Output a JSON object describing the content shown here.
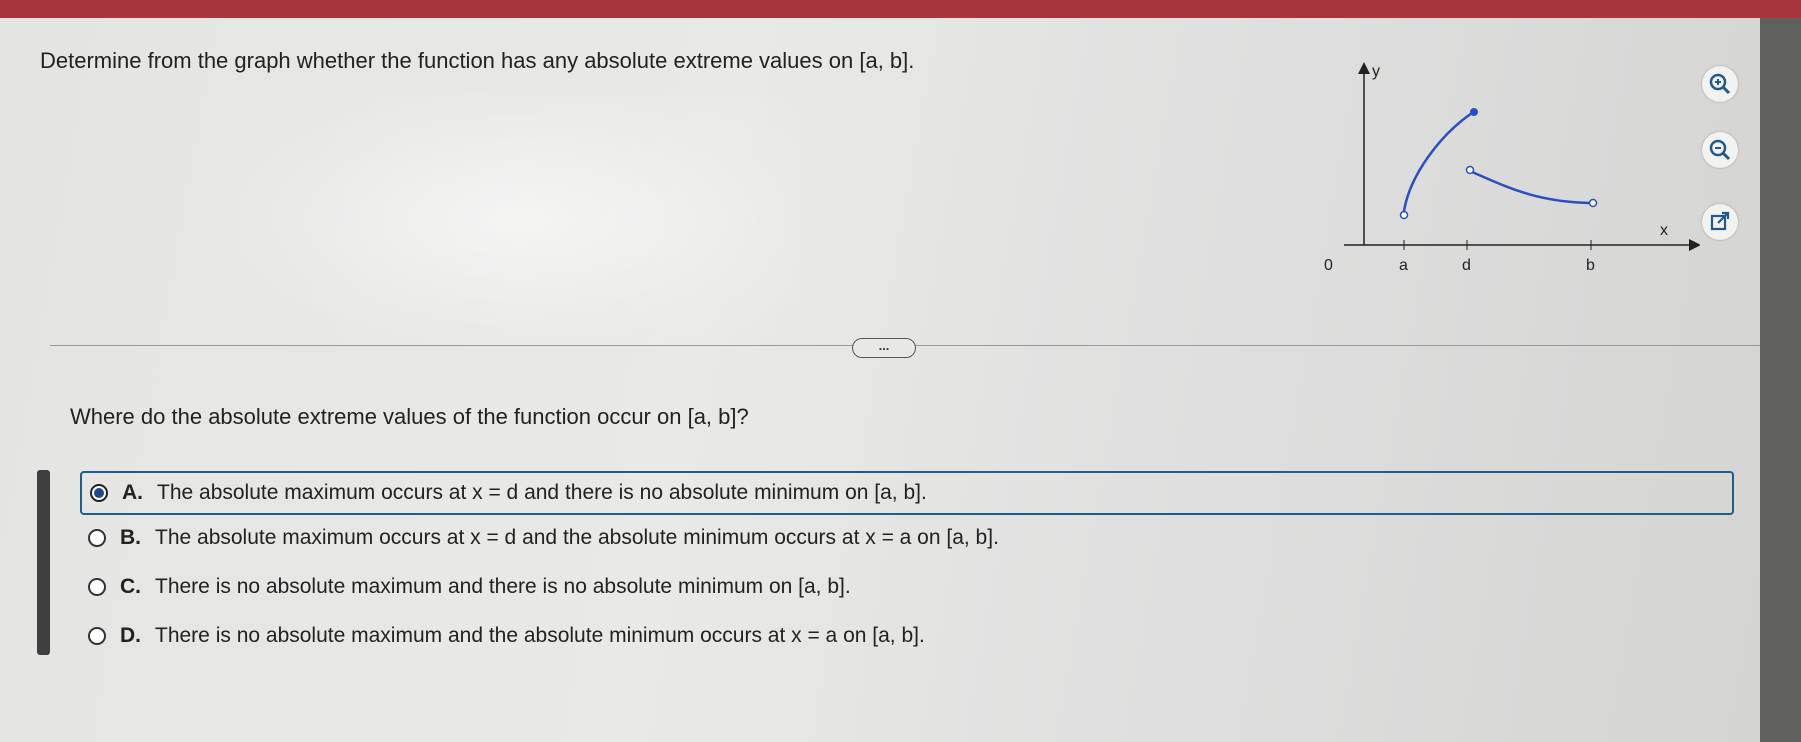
{
  "question_text": "Determine from the graph whether the function has any absolute extreme values on [a, b].",
  "graph": {
    "y_label": "y",
    "x_label": "x",
    "origin_label": "0",
    "tick_a": "a",
    "tick_d": "d",
    "tick_b": "b"
  },
  "tools": [
    "zoom-in-icon",
    "zoom-out-icon",
    "external-link-icon"
  ],
  "more_button_label": "...",
  "prompt_text": "Where do the absolute extreme values of the function occur on [a, b]?",
  "options": [
    {
      "letter": "A.",
      "text": "The absolute maximum occurs at x = d and there is no absolute minimum on [a, b].",
      "selected": true
    },
    {
      "letter": "B.",
      "text": "The absolute maximum occurs at x = d and the absolute minimum occurs at x = a on [a, b].",
      "selected": false
    },
    {
      "letter": "C.",
      "text": "There is no absolute maximum and there is no absolute minimum on [a, b].",
      "selected": false
    },
    {
      "letter": "D.",
      "text": "There is no absolute maximum and the absolute minimum occurs at x = a on [a, b].",
      "selected": false
    }
  ],
  "colors": {
    "curve": "#2a4fbf",
    "selected_border": "#1b5f8c",
    "header": "#a8343e"
  }
}
